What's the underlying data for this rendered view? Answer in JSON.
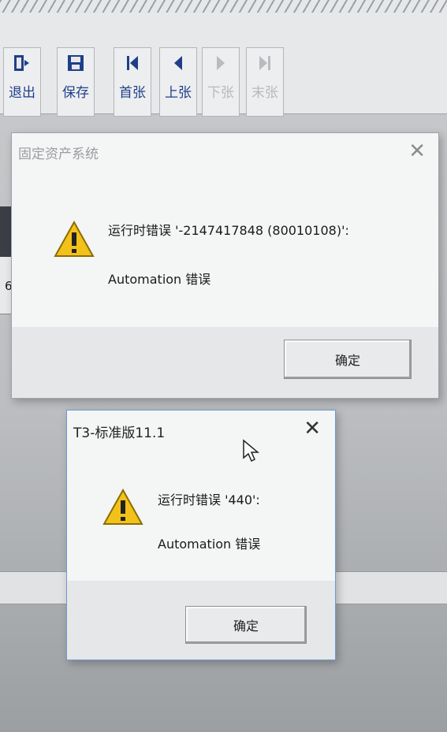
{
  "toolbar": {
    "exit_label": "退出",
    "save_label": "保存",
    "first_label": "首张",
    "prev_label": "上张",
    "next_label": "下张",
    "last_label": "末张"
  },
  "background_text": {
    "row1_char": "6"
  },
  "dialog1": {
    "title": "固定资产系统",
    "close_glyph": "✕",
    "message_line1": "运行时错误 '-2147417848 (80010108)':",
    "message_line2": "Automation 错误",
    "ok_label": "确定"
  },
  "dialog2": {
    "title": "T3-标准版11.1",
    "close_glyph": "✕",
    "message_line1": "运行时错误 '440':",
    "message_line2": "Automation 错误",
    "ok_label": "确定"
  },
  "colors": {
    "accent_blue": "#2a4fa6",
    "warn_yellow": "#f3c21a"
  }
}
